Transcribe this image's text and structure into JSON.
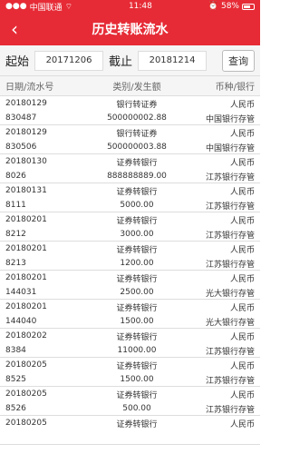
{
  "status": {
    "carrier": "中国联通",
    "time": "11:48",
    "battery": "58%"
  },
  "nav": {
    "title": "历史转账流水"
  },
  "query": {
    "start_label": "起始",
    "start_date": "20171206",
    "end_label": "截止",
    "end_date": "20181214",
    "search_label": "查询"
  },
  "table": {
    "headers": {
      "col1": "日期/流水号",
      "col2": "类别/发生额",
      "col3": "币种/银行"
    },
    "rows": [
      {
        "date": "20180129",
        "serial": "830487",
        "type": "银行转证券",
        "amount": "500000002.88",
        "currency": "人民币",
        "bank": "中国银行存管"
      },
      {
        "date": "20180129",
        "serial": "830506",
        "type": "银行转证券",
        "amount": "500000003.88",
        "currency": "人民币",
        "bank": "中国银行存管"
      },
      {
        "date": "20180130",
        "serial": "8026",
        "type": "证券转银行",
        "amount": "888888889.00",
        "currency": "人民币",
        "bank": "江苏银行存管"
      },
      {
        "date": "20180131",
        "serial": "8111",
        "type": "证券转银行",
        "amount": "5000.00",
        "currency": "人民币",
        "bank": "江苏银行存管"
      },
      {
        "date": "20180201",
        "serial": "8212",
        "type": "证券转银行",
        "amount": "3000.00",
        "currency": "人民币",
        "bank": "江苏银行存管"
      },
      {
        "date": "20180201",
        "serial": "8213",
        "type": "证券转银行",
        "amount": "1200.00",
        "currency": "人民币",
        "bank": "江苏银行存管"
      },
      {
        "date": "20180201",
        "serial": "144031",
        "type": "证券转银行",
        "amount": "2500.00",
        "currency": "人民币",
        "bank": "光大银行存管"
      },
      {
        "date": "20180201",
        "serial": "144040",
        "type": "证券转银行",
        "amount": "1500.00",
        "currency": "人民币",
        "bank": "光大银行存管"
      },
      {
        "date": "20180202",
        "serial": "8384",
        "type": "证券转银行",
        "amount": "11000.00",
        "currency": "人民币",
        "bank": "江苏银行存管"
      },
      {
        "date": "20180205",
        "serial": "8525",
        "type": "证券转银行",
        "amount": "1500.00",
        "currency": "人民币",
        "bank": "江苏银行存管"
      },
      {
        "date": "20180205",
        "serial": "8526",
        "type": "证券转银行",
        "amount": "500.00",
        "currency": "人民币",
        "bank": "江苏银行存管"
      },
      {
        "date": "20180205",
        "serial": "",
        "type": "证券转银行",
        "amount": "",
        "currency": "人民币",
        "bank": ""
      }
    ]
  }
}
